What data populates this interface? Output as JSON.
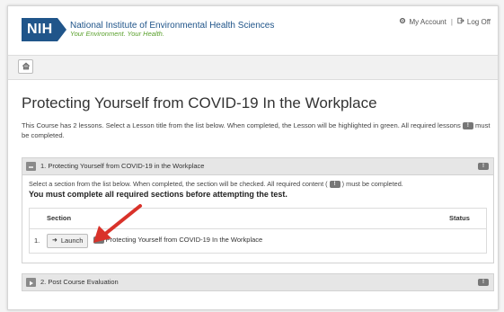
{
  "header": {
    "logo_text": "NIH",
    "org_name": "National Institute of Environmental Health Sciences",
    "org_tagline": "Your Environment. Your Health.",
    "my_account": "My Account",
    "separator": "|",
    "log_off": "Log Off"
  },
  "page": {
    "title": "Protecting Yourself from COVID-19 In the Workplace",
    "intro_part1": "This Course has 2 lessons. Select a Lesson title from the list below. When completed, the Lesson will be highlighted in green. All required lessons",
    "intro_part2": "must be completed.",
    "required_badge_symbol": "!"
  },
  "lessons": [
    {
      "title": "1. Protecting Yourself from COVID-19 in the Workplace",
      "expanded": true,
      "instructions_part1": "Select a section from the list below. When completed, the section will be checked. All required content (",
      "instructions_part2": ") must be completed.",
      "must_complete": "You must complete all required sections before attempting the test.",
      "table": {
        "col_section": "Section",
        "col_status": "Status",
        "rows": [
          {
            "num": "1.",
            "launch_label": "Launch",
            "section_title": "Protecting Yourself from COVID-19 In the Workplace",
            "status": ""
          }
        ]
      }
    },
    {
      "title": "2. Post Course Evaluation",
      "expanded": false
    }
  ],
  "icons": {
    "gear": "gear-icon",
    "logoff": "logoff-icon",
    "home": "home-icon",
    "collapse": "minus-square-icon",
    "expand": "play-square-icon",
    "required": "exclamation-icon",
    "annotation": "red-arrow-icon"
  },
  "colors": {
    "nih_blue": "#20558a",
    "tagline_green": "#5aa02c",
    "annotation_red": "#d9322a"
  }
}
